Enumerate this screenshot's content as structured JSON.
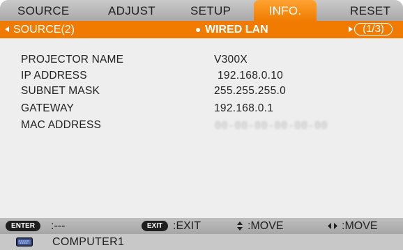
{
  "menu": {
    "tabs": [
      {
        "label": "SOURCE"
      },
      {
        "label": "ADJUST"
      },
      {
        "label": "SETUP"
      },
      {
        "label": "INFO."
      },
      {
        "label": "RESET"
      }
    ],
    "active_tab": "INFO."
  },
  "subheader": {
    "prev_label": "SOURCE(2)",
    "current_label": "WIRED LAN",
    "page_indicator": "1/3"
  },
  "info": [
    {
      "label": "PROJECTOR NAME",
      "value": "V300X"
    },
    {
      "label": "IP ADDRESS",
      "value": "192.168.0.10"
    },
    {
      "label": "SUBNET MASK",
      "value": "255.255.255.0"
    },
    {
      "label": "GATEWAY",
      "value": "192.168.0.1"
    },
    {
      "label": "MAC ADDRESS",
      "value": "00-00-00-00-00-00"
    }
  ],
  "guide": {
    "enter_key": "ENTER",
    "enter_text": ":---",
    "exit_key": "EXIT",
    "exit_text": ":EXIT",
    "move_vertical_text": ":MOVE",
    "move_horizontal_text": ":MOVE"
  },
  "footer": {
    "source_name": "COMPUTER1",
    "source_icon": "computer-monitor-icon"
  },
  "colors": {
    "accent": "#f07b00",
    "menu_bar": "#b9b9b9",
    "panel": "#eeeeee",
    "text": "#222222"
  }
}
